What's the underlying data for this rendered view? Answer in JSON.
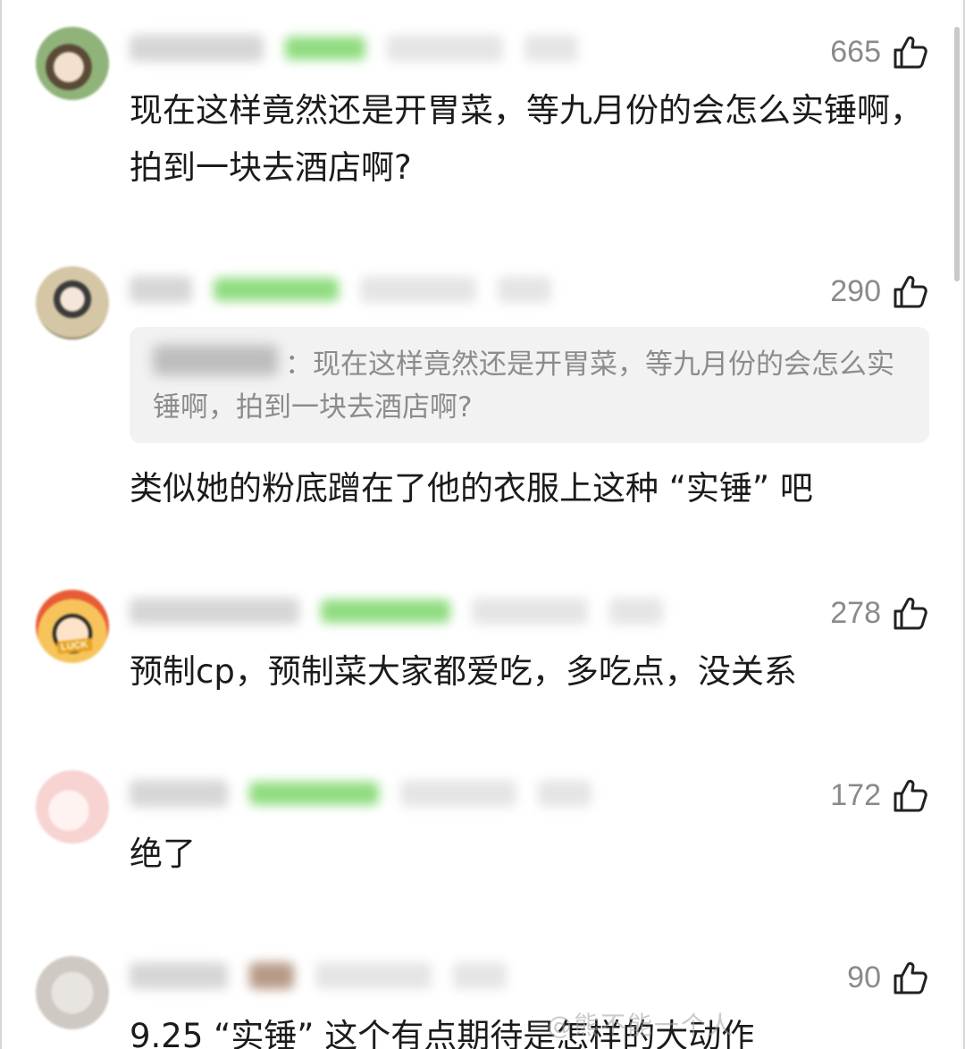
{
  "comments": [
    {
      "likes": "665",
      "text": "现在这样竟然还是开胃菜，等九月份的会怎么实锤啊，拍到一块去酒店啊?"
    },
    {
      "likes": "290",
      "quote": "：现在这样竟然还是开胃菜，等九月份的会怎么实锤啊，拍到一块去酒店啊?",
      "text": "类似她的粉底蹭在了他的衣服上这种 “实锤” 吧"
    },
    {
      "likes": "278",
      "avatar_badge": "LUCK",
      "text": "预制cp，预制菜大家都爱吃，多吃点，没关系"
    },
    {
      "likes": "172",
      "text": "绝了"
    },
    {
      "likes": "90",
      "text": "9.25 “实锤” 这个有点期待是怎样的大动作"
    }
  ],
  "icons": {
    "like": "thumbs-up-icon"
  },
  "watermark": "@熊不能一个人"
}
